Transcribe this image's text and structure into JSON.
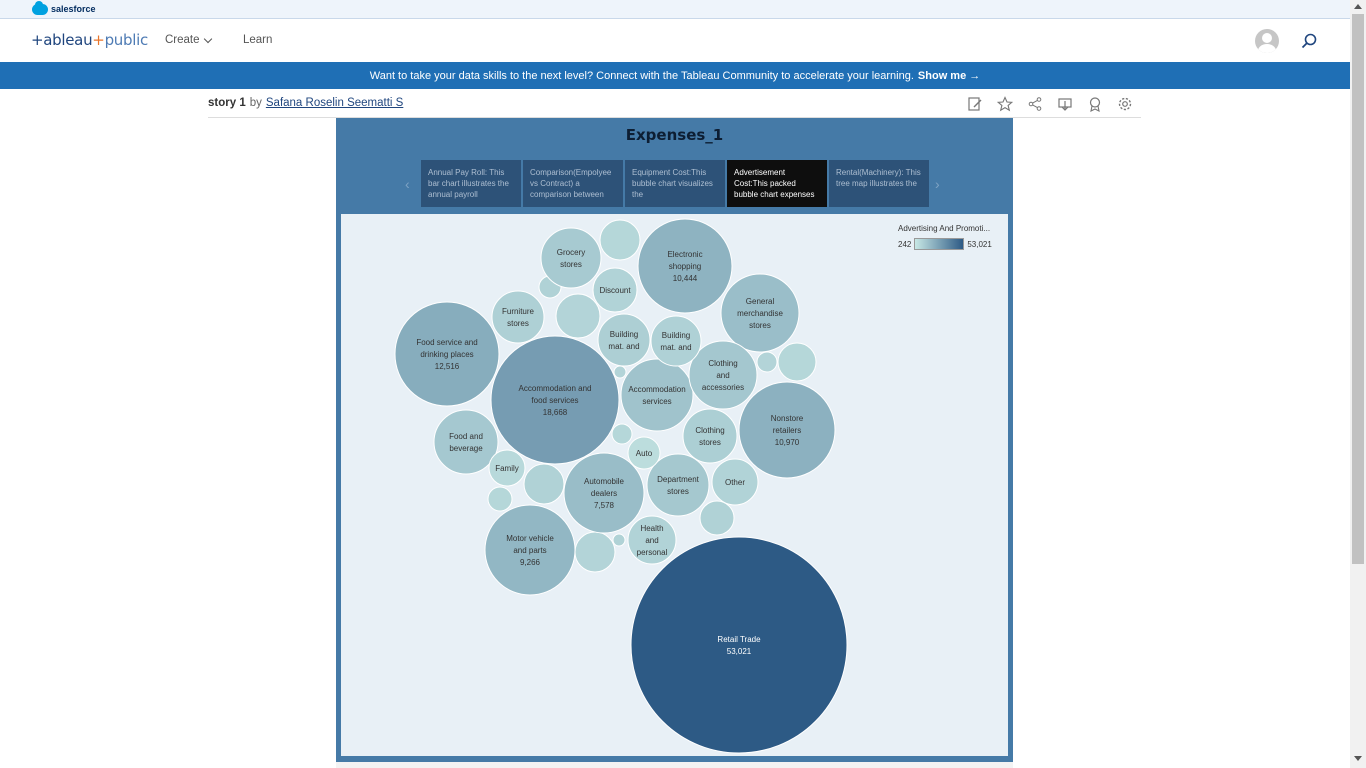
{
  "salesforce": {
    "label": "salesforce"
  },
  "nav": {
    "brand_pre": "+ableau",
    "brand_plus": "+",
    "brand_post": "public",
    "create_label": "Create",
    "learn_label": "Learn"
  },
  "banner": {
    "text": "Want to take your data skills to the next level? Connect with the Tableau Community to accelerate your learning.",
    "link": "Show me →"
  },
  "story": {
    "title": "story 1",
    "by": "by",
    "author": "Safana Roselin Seematti S"
  },
  "viz": {
    "title": "Expenses_1",
    "story_points": [
      "Annual Pay Roll: This bar chart illustrates the annual payroll",
      "Comparison(Empolyee vs Contract) a comparison between",
      "Equipment Cost:This bubble chart visualizes the",
      "Advertisement Cost:This packed bubble chart expenses",
      "Rental(Machinery): This tree map illustrates the"
    ],
    "active_point": 3,
    "legend": {
      "title": "Advertising And Promoti...",
      "min": "242",
      "max": "53,021"
    }
  },
  "colors": {
    "low": "#c8e8e5",
    "high": "#2d5a85",
    "banner": "#1f6fb5"
  },
  "chart_data": {
    "type": "packed-bubble",
    "measure": "Advertising And Promoti...",
    "color_range": [
      242,
      53021
    ],
    "bubbles": [
      {
        "label": "Retail Trade",
        "value": 53021,
        "value_label": "53,021"
      },
      {
        "label": "Accommodation and food services",
        "value": 18668,
        "value_label": "18,668"
      },
      {
        "label": "Food service and drinking places",
        "value": 12516,
        "value_label": "12,516"
      },
      {
        "label": "Nonstore retailers",
        "value": 10970,
        "value_label": "10,970"
      },
      {
        "label": "Electronic shopping",
        "value": 10444,
        "value_label": "10,444"
      },
      {
        "label": "Motor vehicle and parts",
        "value": 9266,
        "value_label": "9,266"
      },
      {
        "label": "Automobile dealers",
        "value": 7578,
        "value_label": "7,578"
      },
      {
        "label": "General merchandise stores",
        "value": 7200,
        "value_label": ""
      },
      {
        "label": "Accommodation services",
        "value": 5800,
        "value_label": ""
      },
      {
        "label": "Department stores",
        "value": 4700,
        "value_label": ""
      },
      {
        "label": "Clothing and accessories",
        "value": 4800,
        "value_label": ""
      },
      {
        "label": "Food and beverage",
        "value": 4600,
        "value_label": ""
      },
      {
        "label": "Grocery stores",
        "value": 4200,
        "value_label": ""
      },
      {
        "label": "Building mat. and",
        "value": 3100,
        "value_label": ""
      },
      {
        "label": "Building mat. and",
        "value": 2700,
        "value_label": ""
      },
      {
        "label": "Clothing stores",
        "value": 3200,
        "value_label": ""
      },
      {
        "label": "Furniture stores",
        "value": 3000,
        "value_label": ""
      },
      {
        "label": "Discount",
        "value": 2400,
        "value_label": ""
      },
      {
        "label": "Other",
        "value": 2400,
        "value_label": ""
      },
      {
        "label": "Health and personal",
        "value": 2500,
        "value_label": ""
      },
      {
        "label": "Family",
        "value": 1500,
        "value_label": ""
      },
      {
        "label": "Auto",
        "value": 1000,
        "value_label": ""
      }
    ]
  }
}
